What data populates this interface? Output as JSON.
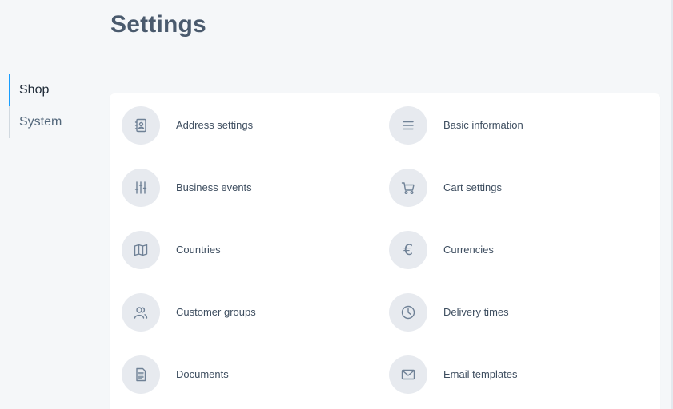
{
  "page": {
    "title": "Settings"
  },
  "sidebar": {
    "items": [
      {
        "label": "Shop",
        "active": true
      },
      {
        "label": "System",
        "active": false
      }
    ]
  },
  "settings": {
    "items": [
      {
        "label": "Address settings",
        "icon": "address-book-icon"
      },
      {
        "label": "Basic information",
        "icon": "list-lines-icon"
      },
      {
        "label": "Business events",
        "icon": "sliders-icon"
      },
      {
        "label": "Cart settings",
        "icon": "cart-icon"
      },
      {
        "label": "Countries",
        "icon": "map-icon"
      },
      {
        "label": "Currencies",
        "icon": "euro-icon"
      },
      {
        "label": "Customer groups",
        "icon": "users-icon"
      },
      {
        "label": "Delivery times",
        "icon": "clock-icon"
      },
      {
        "label": "Documents",
        "icon": "document-icon"
      },
      {
        "label": "Email templates",
        "icon": "envelope-icon"
      }
    ]
  },
  "colors": {
    "background": "#f5f7f9",
    "card": "#ffffff",
    "icon_circle": "#e7eaef",
    "icon_stroke": "#6f8196",
    "active_nav_border": "#189eff",
    "title": "#4a5a6d"
  }
}
